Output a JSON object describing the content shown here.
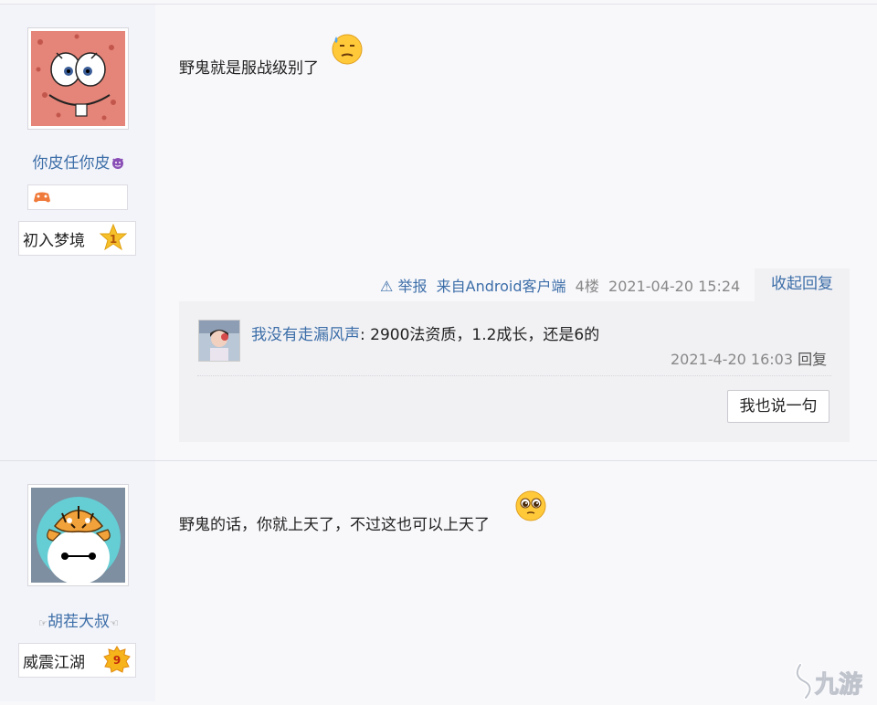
{
  "posts": [
    {
      "user": {
        "name": "你皮任你皮",
        "level_title": "初入梦境",
        "level_num": "1"
      },
      "content": "野鬼就是服战级别了",
      "meta": {
        "report": "举报",
        "source": "来自Android客户端",
        "floor": "4楼",
        "time": "2021-04-20 15:24"
      },
      "collapse_label": "收起回复",
      "replies": [
        {
          "user": "我没有走漏风声",
          "text": ": 2900法资质，1.2成长，还是6的",
          "time": "2021-4-20 16:03",
          "reply_label": "回复"
        }
      ],
      "say_button": "我也说一句"
    },
    {
      "user": {
        "name": "胡茬大叔",
        "level_title": "威震江湖",
        "level_num": "9"
      },
      "content": "野鬼的话，你就上天了，不过这也可以上天了"
    }
  ],
  "watermark": "九游",
  "colors": {
    "link": "#3d6ea8",
    "star": "#f6c02a",
    "avatar1_bg": "#e58478",
    "avatar2_bg": "#65cdd4"
  }
}
